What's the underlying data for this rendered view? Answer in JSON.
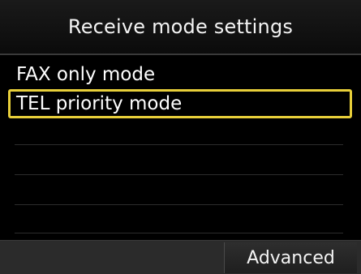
{
  "header": {
    "title": "Receive mode settings"
  },
  "menu": {
    "items": [
      {
        "label": "FAX only mode",
        "selected": false
      },
      {
        "label": "TEL priority mode",
        "selected": true
      }
    ]
  },
  "footer": {
    "advanced_label": "Advanced"
  },
  "colors": {
    "background": "#000000",
    "selection_border": "#e8cf3a",
    "text": "#ffffff"
  }
}
